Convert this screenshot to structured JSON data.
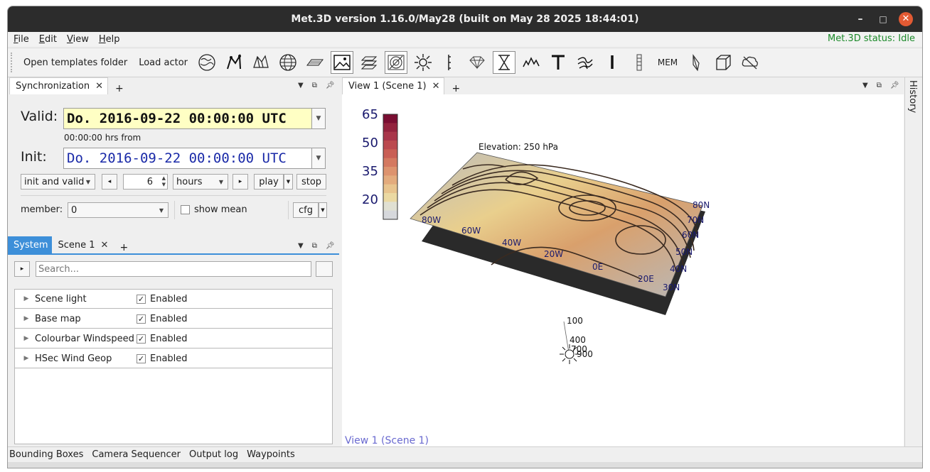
{
  "window": {
    "title": "Met.3D version 1.16.0/May28 (built on May 28 2025 18:44:01)",
    "controls": {
      "minimize": "–",
      "maximize": "□",
      "close": "✕"
    }
  },
  "menu": {
    "items": [
      "File",
      "Edit",
      "View",
      "Help"
    ],
    "status": "Met.3D status: Idle"
  },
  "toolbar": {
    "open_templates": "Open templates folder",
    "load_actor": "Load actor",
    "mem_label": "MEM",
    "icons": [
      "globe-icon",
      "trajectory-icon",
      "volume-icon",
      "grid-globe-icon",
      "plane-icon",
      "image-icon",
      "layers-icon",
      "isosurface-icon",
      "light-icon",
      "vertical-line-icon",
      "diamond-icon",
      "hourglass-icon",
      "mountain-icon",
      "text-icon",
      "wind-icon",
      "bar-icon",
      "colorbar-icon",
      "mem-icon",
      "leaf-icon",
      "cube-icon",
      "cloud-icon"
    ]
  },
  "sync": {
    "tab_label": "Synchronization",
    "valid_label": "Valid:",
    "valid_value": "Do. 2016-09-22 00:00:00 UTC",
    "hrs_from": "00:00:00 hrs from",
    "init_label": "Init:",
    "init_value": "Do. 2016-09-22 00:00:00 UTC",
    "mode_value": "init and valid",
    "step_value": "6",
    "unit_value": "hours",
    "play_label": "play",
    "stop_label": "stop",
    "member_label": "member:",
    "member_value": "0",
    "show_mean_label": "show mean",
    "cfg_label": "cfg"
  },
  "system_panel": {
    "tabs": [
      "System",
      "Scene 1"
    ],
    "search_placeholder": "Search...",
    "actors": [
      {
        "name": "Scene light",
        "enabled_label": "Enabled",
        "enabled": true
      },
      {
        "name": "Base map",
        "enabled_label": "Enabled",
        "enabled": true
      },
      {
        "name": "Colourbar Windspeed",
        "enabled_label": "Enabled",
        "enabled": true
      },
      {
        "name": "HSec Wind Geop",
        "enabled_label": "Enabled",
        "enabled": true
      }
    ]
  },
  "view": {
    "tab_label": "View 1 (Scene 1)",
    "footer_label": "View 1 (Scene 1)",
    "elevation_label": "Elevation: 250 hPa",
    "colorbar_ticks": [
      "65",
      "50",
      "35",
      "20"
    ],
    "colorbar_colors": [
      "#7a0e32",
      "#93233e",
      "#a8364a",
      "#bb4a4f",
      "#c95f55",
      "#d47960",
      "#dd936e",
      "#e3ab7d",
      "#e8c48e",
      "#ebd9a2",
      "#e0e0d2",
      "#d6d8dc"
    ],
    "lon_labels": [
      "80W",
      "60W",
      "40W",
      "20W",
      "0E",
      "20E"
    ],
    "lat_labels": [
      "80N",
      "70N",
      "60N",
      "50N",
      "40N",
      "30N"
    ],
    "pressure_labels": [
      "100",
      "400",
      "700",
      "900"
    ]
  },
  "history_label": "History",
  "bottom_tabs": [
    "Bounding Boxes",
    "Camera Sequencer",
    "Output log",
    "Waypoints"
  ]
}
